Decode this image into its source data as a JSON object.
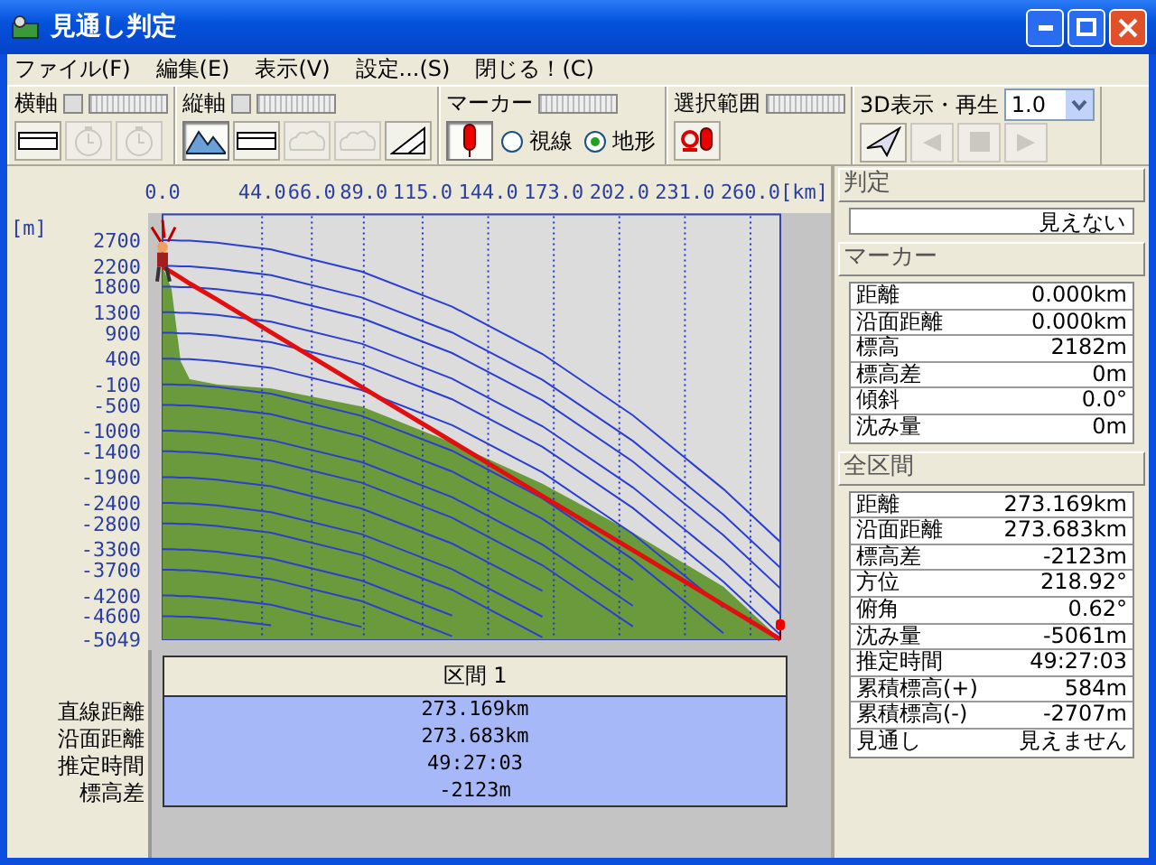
{
  "window": {
    "title": "見通し判定"
  },
  "menu": [
    "ファイル(F)",
    "編集(E)",
    "表示(V)",
    "設定...(S)",
    "閉じる！(C)"
  ],
  "toolbar": [
    {
      "label": "横軸",
      "toggle_button": true,
      "slider": true,
      "tools": [
        {
          "kind": "ruler",
          "pressed": false,
          "disabled": false
        },
        {
          "kind": "clock",
          "pressed": false,
          "disabled": true
        },
        {
          "kind": "clock",
          "pressed": false,
          "disabled": true
        }
      ]
    },
    {
      "label": "縦軸",
      "toggle_button": true,
      "slider": true,
      "tools": [
        {
          "kind": "mountain",
          "pressed": true,
          "disabled": false
        },
        {
          "kind": "ruler",
          "pressed": false,
          "disabled": false
        },
        {
          "kind": "cloud",
          "pressed": false,
          "disabled": true
        },
        {
          "kind": "cloud",
          "pressed": false,
          "disabled": true
        },
        {
          "kind": "triangle",
          "pressed": false,
          "disabled": false
        }
      ]
    },
    {
      "label": "マーカー",
      "toggle_button": false,
      "slider": true,
      "tools": [
        {
          "kind": "pin",
          "pressed": true,
          "disabled": false
        },
        {
          "kind": "radio",
          "label": "視線",
          "selected": false
        },
        {
          "kind": "radio",
          "label": "地形",
          "selected": true
        }
      ]
    },
    {
      "label": "選択範囲",
      "toggle_button": false,
      "slider": true,
      "tools": [
        {
          "kind": "loop-pin",
          "pressed": false,
          "disabled": false
        }
      ]
    },
    {
      "label": "3D表示・再生",
      "toggle_button": false,
      "slider": false,
      "select": {
        "value": "1.0"
      },
      "tools": [
        {
          "kind": "plane",
          "pressed": false,
          "disabled": false
        },
        {
          "kind": "prev",
          "pressed": false,
          "disabled": true
        },
        {
          "kind": "stop",
          "pressed": false,
          "disabled": true
        },
        {
          "kind": "next",
          "pressed": false,
          "disabled": true
        }
      ]
    }
  ],
  "chart": {
    "chart_data": {
      "type": "area",
      "xlabel": "[km]",
      "ylabel": "[m]",
      "grid": true,
      "x": [
        0,
        4,
        8,
        12,
        24,
        48,
        88,
        128,
        168,
        208,
        248,
        273.169
      ],
      "series": [
        {
          "type": "area",
          "color": "#6b9a3c",
          "values": [
            2180,
            1750,
            350,
            0,
            -100,
            -180,
            -530,
            -1230,
            -2030,
            -2980,
            -4030,
            -5049
          ]
        },
        {
          "type": "line",
          "color": "#2a3fd0",
          "values": [
            2700,
            2700,
            2690,
            2690,
            2650,
            2520,
            2090,
            1410,
            490,
            -700,
            -2130,
            -3160
          ]
        },
        {
          "type": "line",
          "color": "#2a3fd0",
          "values": [
            2200,
            2200,
            2190,
            2190,
            2150,
            2020,
            1590,
            910,
            -10,
            -1200,
            -2630,
            -3660
          ]
        },
        {
          "type": "line",
          "color": "#2a3fd0",
          "values": [
            1800,
            1800,
            1790,
            1790,
            1750,
            1620,
            1190,
            510,
            -410,
            -1600,
            -3030,
            -4060
          ]
        },
        {
          "type": "line",
          "color": "#2a3fd0",
          "values": [
            1300,
            1300,
            1290,
            1290,
            1250,
            1120,
            690,
            10,
            -910,
            -2100,
            -3530,
            -4560
          ]
        },
        {
          "type": "line",
          "color": "#2a3fd0",
          "values": [
            900,
            900,
            890,
            890,
            850,
            720,
            290,
            -390,
            -1310,
            -2500,
            -3930,
            -4960
          ]
        },
        {
          "type": "line",
          "color": "#2a3fd0",
          "values": [
            400,
            400,
            390,
            390,
            350,
            220,
            -210,
            -890,
            -1810,
            -3000,
            -4430,
            null
          ]
        },
        {
          "type": "line",
          "color": "#2a3fd0",
          "values": [
            -100,
            -100,
            -110,
            -110,
            -150,
            -280,
            -710,
            -1390,
            -2310,
            -3500,
            -4930,
            null
          ]
        },
        {
          "type": "line",
          "color": "#2a3fd0",
          "values": [
            -500,
            -500,
            -510,
            -510,
            -550,
            -680,
            -1110,
            -1790,
            -2710,
            -3900,
            null,
            null
          ]
        },
        {
          "type": "line",
          "color": "#2a3fd0",
          "values": [
            -1000,
            -1000,
            -1010,
            -1010,
            -1050,
            -1180,
            -1610,
            -2290,
            -3210,
            -4400,
            null,
            null
          ]
        },
        {
          "type": "line",
          "color": "#2a3fd0",
          "values": [
            -1400,
            -1400,
            -1410,
            -1410,
            -1450,
            -1580,
            -2010,
            -2690,
            -3610,
            -4800,
            null,
            null
          ]
        },
        {
          "type": "line",
          "color": "#2a3fd0",
          "values": [
            -1900,
            -1900,
            -1910,
            -1910,
            -1950,
            -2080,
            -2510,
            -3190,
            -4110,
            null,
            null,
            null
          ]
        },
        {
          "type": "line",
          "color": "#2a3fd0",
          "values": [
            -2400,
            -2400,
            -2410,
            -2410,
            -2450,
            -2580,
            -3010,
            -3690,
            -4610,
            null,
            null,
            null
          ]
        },
        {
          "type": "line",
          "color": "#2a3fd0",
          "values": [
            -2800,
            -2800,
            -2810,
            -2810,
            -2850,
            -2980,
            -3410,
            -4090,
            -5010,
            null,
            null,
            null
          ]
        },
        {
          "type": "line",
          "color": "#2a3fd0",
          "values": [
            -3300,
            -3300,
            -3310,
            -3310,
            -3350,
            -3480,
            -3910,
            -4590,
            null,
            null,
            null,
            null
          ]
        },
        {
          "type": "line",
          "color": "#2a3fd0",
          "values": [
            -3700,
            -3700,
            -3710,
            -3710,
            -3750,
            -3880,
            -4310,
            -4990,
            null,
            null,
            null,
            null
          ]
        },
        {
          "type": "line",
          "color": "#2a3fd0",
          "values": [
            -4200,
            -4200,
            -4210,
            -4210,
            -4250,
            -4380,
            -4810,
            null,
            null,
            null,
            null,
            null
          ]
        },
        {
          "type": "line",
          "color": "#2a3fd0",
          "values": [
            -4600,
            -4600,
            -4610,
            -4610,
            -4650,
            -4780,
            null,
            null,
            null,
            null,
            null,
            null
          ]
        },
        {
          "type": "line",
          "color": "#e01010",
          "values": [
            2180,
            2080,
            1970,
            1860,
            1550,
            910,
            -150,
            -1210,
            -2270,
            -3320,
            -4380,
            -5049
          ]
        }
      ],
      "xlim": [
        0,
        273.169
      ],
      "ylim": [
        -5049,
        3200
      ],
      "xticks": [
        {
          "value": 0,
          "label": "0.0"
        },
        {
          "value": 44,
          "label": "44.0"
        },
        {
          "value": 66,
          "label": "66.0"
        },
        {
          "value": 89,
          "label": "89.0"
        },
        {
          "value": 115,
          "label": "115.0"
        },
        {
          "value": 144,
          "label": "144.0"
        },
        {
          "value": 173,
          "label": "173.0"
        },
        {
          "value": 202,
          "label": "202.0"
        },
        {
          "value": 231,
          "label": "231.0"
        },
        {
          "value": 260,
          "label": "260.0"
        }
      ],
      "yticks": [
        2700,
        2200,
        1800,
        1300,
        900,
        400,
        -100,
        -500,
        -1000,
        -1400,
        -1900,
        -2400,
        -2800,
        -3300,
        -3700,
        -4200,
        -4600,
        -5049
      ]
    }
  },
  "section_table": {
    "header": "区間 1",
    "rows": [
      {
        "label": "直線距離",
        "value": "273.169km"
      },
      {
        "label": "沿面距離",
        "value": "273.683km"
      },
      {
        "label": "推定時間",
        "value": "49:27:03"
      },
      {
        "label": "標高差",
        "value": "-2123m"
      }
    ]
  },
  "right_panel": [
    {
      "title": "判定",
      "kind": "field",
      "value": "見えない"
    },
    {
      "title": "マーカー",
      "kind": "table",
      "rows": [
        {
          "label": "距離",
          "value": "0.000km"
        },
        {
          "label": "沿面距離",
          "value": "0.000km"
        },
        {
          "label": "標高",
          "value": "2182m"
        },
        {
          "label": "標高差",
          "value": "0m"
        },
        {
          "label": "傾斜",
          "value": "0.0°"
        },
        {
          "label": "沈み量",
          "value": "0m"
        }
      ]
    },
    {
      "title": "全区間",
      "kind": "table",
      "rows": [
        {
          "label": "距離",
          "value": "273.169km"
        },
        {
          "label": "沿面距離",
          "value": "273.683km"
        },
        {
          "label": "標高差",
          "value": "-2123m"
        },
        {
          "label": "方位",
          "value": "218.92°"
        },
        {
          "label": "俯角",
          "value": "0.62°"
        },
        {
          "label": "沈み量",
          "value": "-5061m"
        },
        {
          "label": "推定時間",
          "value": "49:27:03"
        },
        {
          "label": "累積標高(+)",
          "value": "584m"
        },
        {
          "label": "累積標高(-)",
          "value": "-2707m"
        },
        {
          "label": "見通し",
          "value": "見えません"
        }
      ]
    }
  ]
}
